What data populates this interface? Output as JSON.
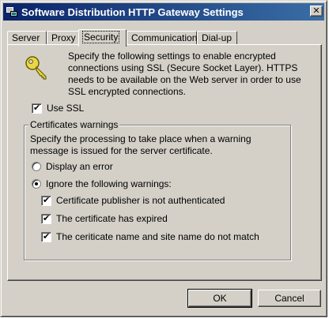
{
  "window": {
    "title": "Software Distribution HTTP Gateway Settings",
    "close_glyph": "✕"
  },
  "tabs": [
    {
      "label": "Server",
      "active": false
    },
    {
      "label": "Proxy",
      "active": false
    },
    {
      "label": "Security",
      "active": true
    },
    {
      "label": "Communication",
      "active": false
    },
    {
      "label": "Dial-up",
      "active": false
    }
  ],
  "security": {
    "description": "Specify the following settings to enable encrypted connections using SSL (Secure Socket Layer). HTTPS needs to be available on the Web server in order to use SSL encrypted connections.",
    "use_ssl": {
      "label": "Use SSL",
      "checked": true
    },
    "cert_group": {
      "title": "Certificates warnings",
      "description": "Specify the processing to take place when a warning message is issued for the server certificate.",
      "display_error": {
        "label": "Display an error",
        "selected": false
      },
      "ignore_warnings": {
        "label": "Ignore the following warnings:",
        "selected": true
      },
      "publisher_not_authenticated": {
        "label": "Certificate publisher is not authenticated",
        "checked": true
      },
      "cert_expired": {
        "label": "The certificate has expired",
        "checked": true
      },
      "name_mismatch": {
        "label": "The ceriticate name and site name do not match",
        "checked": true
      }
    }
  },
  "buttons": {
    "ok": "OK",
    "cancel": "Cancel"
  },
  "icons": {
    "app": "network-computers-icon",
    "key": "key-icon",
    "checkmark": "✔"
  }
}
